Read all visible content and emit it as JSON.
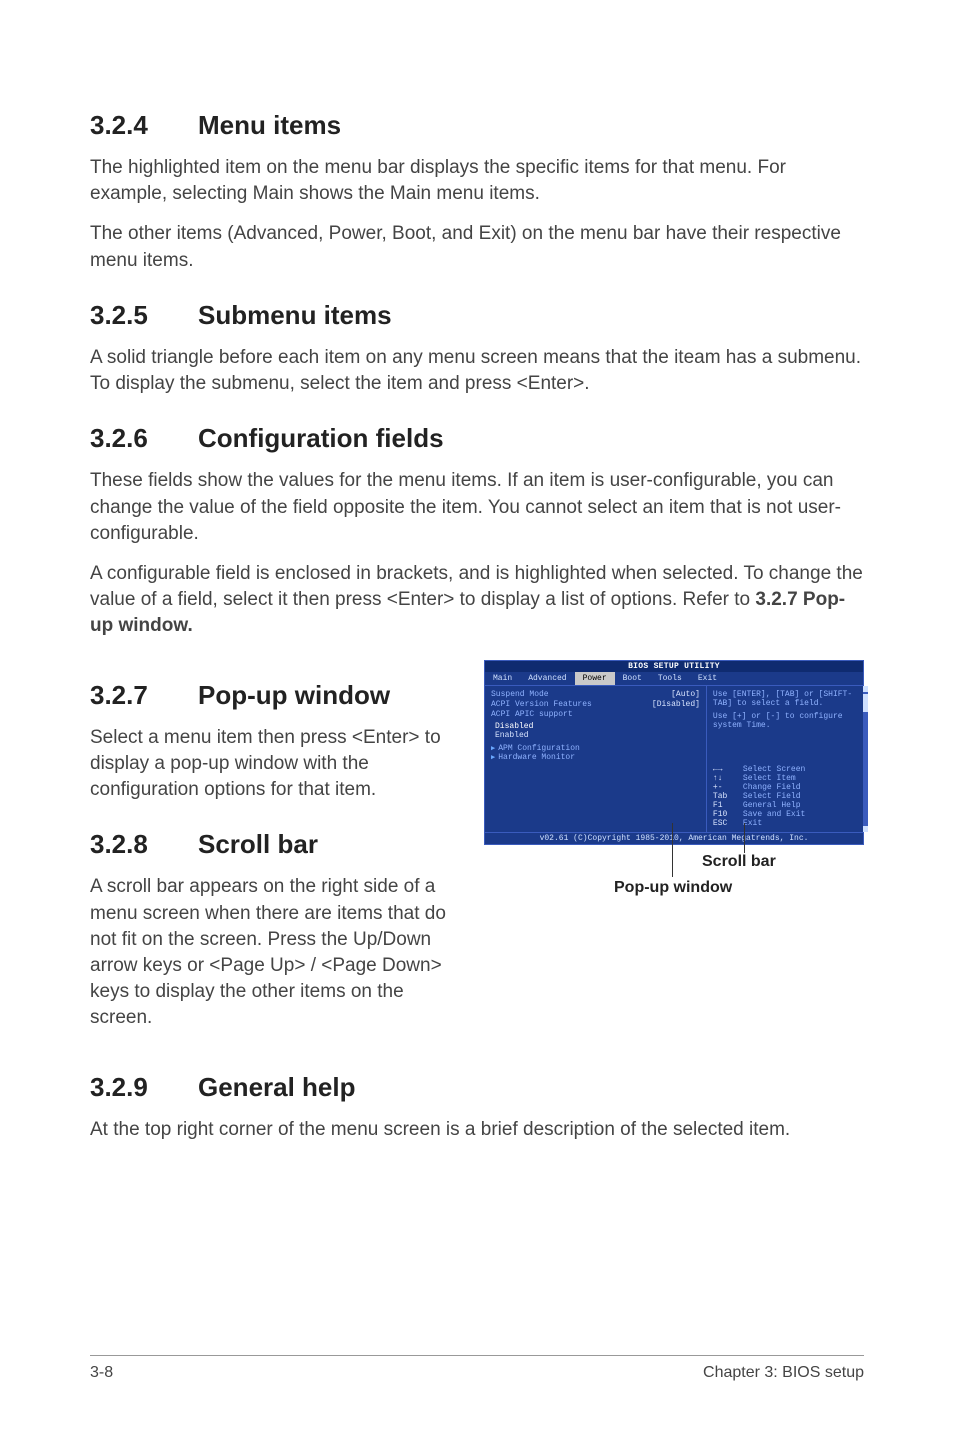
{
  "sections": {
    "s324": {
      "num": "3.2.4",
      "title": "Menu items",
      "p1": "The highlighted item on the menu bar displays the specific items for that menu. For example, selecting Main shows the Main menu items.",
      "p2": "The other items (Advanced, Power, Boot, and Exit) on the menu bar have their respective menu items."
    },
    "s325": {
      "num": "3.2.5",
      "title": "Submenu items",
      "p1": "A solid triangle before each item on any menu screen means that the iteam has a submenu. To display the submenu, select the item and press <Enter>."
    },
    "s326": {
      "num": "3.2.6",
      "title": "Configuration fields",
      "p1": "These fields show the values for the menu items. If an item is user-configurable, you can change the value of the field opposite the item. You cannot select an item that is not user-configurable.",
      "p2a": "A configurable field is enclosed in brackets, and is highlighted when selected. To change the value of a field, select it then press <Enter> to display a list of options. Refer to ",
      "p2b": "3.2.7 Pop-up window."
    },
    "s327": {
      "num": "3.2.7",
      "title": "Pop-up window",
      "p1": "Select a menu item then press <Enter> to display a pop-up window with the configuration options for that item."
    },
    "s328": {
      "num": "3.2.8",
      "title": "Scroll bar",
      "p1": "A scroll bar appears on the right side of a menu screen when there are items that do not fit on the screen. Press the Up/Down arrow keys or <Page Up> / <Page Down> keys to display the other items on the screen."
    },
    "s329": {
      "num": "3.2.9",
      "title": "General help",
      "p1": "At the top right corner of the menu screen is a brief description of the selected item."
    }
  },
  "bios": {
    "title_bar": "BIOS SETUP UTILITY",
    "tabs": [
      "Main",
      "Advanced",
      "Power",
      "Boot",
      "Tools",
      "Exit"
    ],
    "selected_tab": "Power",
    "left_items": [
      {
        "label": "Suspend Mode",
        "value": "[Auto]"
      },
      {
        "label": "ACPI Version Features",
        "value": "[Disabled]"
      },
      {
        "label": "ACPI APIC support",
        "value": ""
      }
    ],
    "popup_options": [
      "Disabled",
      "Enabled"
    ],
    "popup_selected": "Disabled",
    "submenu_items": [
      "APM Configuration",
      "Hardware Monitor"
    ],
    "help_text_1": "Use [ENTER], [TAB] or [SHIFT-TAB] to select a field.",
    "help_text_2": "Use [+] or [-] to configure system Time.",
    "nav_keys": [
      {
        "k": "←→",
        "d": "Select Screen"
      },
      {
        "k": "↑↓",
        "d": "Select Item"
      },
      {
        "k": "+-",
        "d": "Change Field"
      },
      {
        "k": "Tab",
        "d": "Select Field"
      },
      {
        "k": "F1",
        "d": "General Help"
      },
      {
        "k": "F10",
        "d": "Save and Exit"
      },
      {
        "k": "ESC",
        "d": "Exit"
      }
    ],
    "footer": "v02.61 (C)Copyright 1985-2010, American Megatrends, Inc."
  },
  "callouts": {
    "scroll": "Scroll bar",
    "popup": "Pop-up window"
  },
  "page_footer": {
    "left": "3-8",
    "right": "Chapter 3: BIOS setup"
  }
}
